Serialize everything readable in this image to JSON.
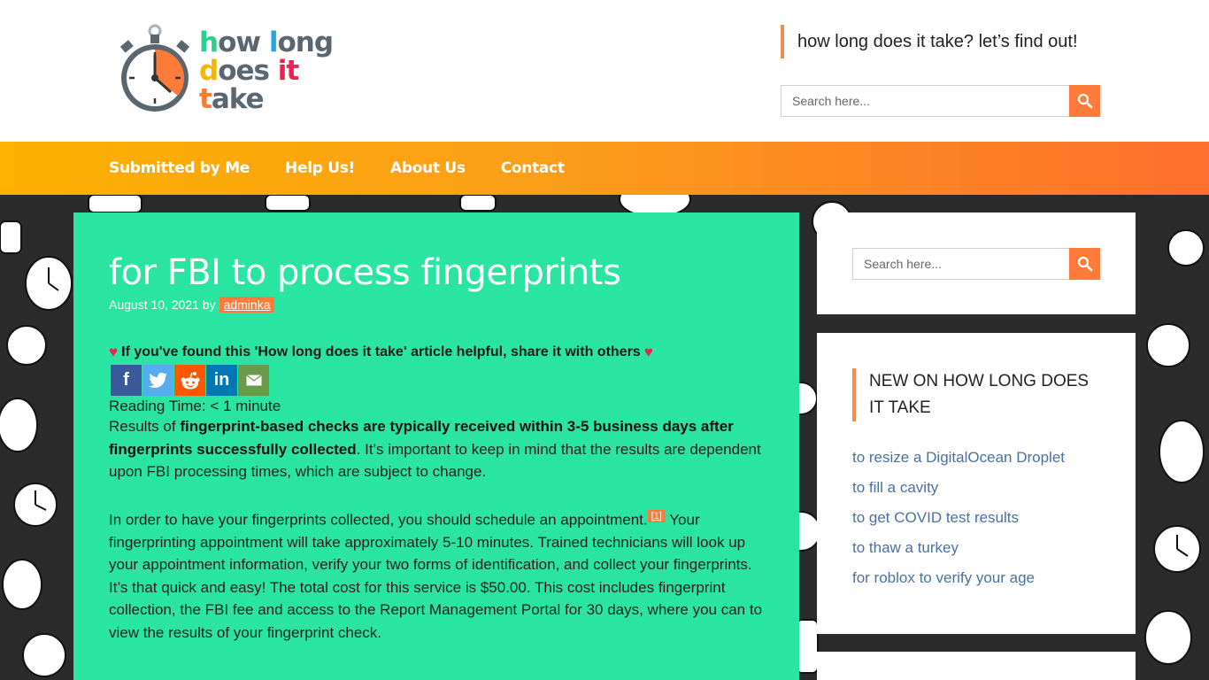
{
  "site": {
    "logo_lines": [
      [
        "how",
        " ",
        "l",
        "ong"
      ],
      [
        "d",
        "oes ",
        "it"
      ],
      [
        "t",
        "ake"
      ]
    ],
    "logo_alt": "how long does it take",
    "tagline": "how long does it take? let’s find out!"
  },
  "header_search": {
    "placeholder": "Search here...",
    "button_icon": "search-icon"
  },
  "nav": {
    "items": [
      {
        "label": "Submitted by Me"
      },
      {
        "label": "Help Us!"
      },
      {
        "label": "About Us"
      },
      {
        "label": "Contact"
      }
    ]
  },
  "post": {
    "title": "for FBI to process fingerprints",
    "date": "August 10, 2021",
    "by": "by",
    "author": "adminka",
    "share_text": "If you've found this 'How long does it take' article helpful, share it with others",
    "social": [
      {
        "name": "facebook",
        "glyph": "f",
        "color": "#3b5998"
      },
      {
        "name": "twitter",
        "glyph": "t",
        "color": "#55acee"
      },
      {
        "name": "reddit",
        "glyph": "r",
        "color": "#ff5700"
      },
      {
        "name": "linkedin",
        "glyph": "in",
        "color": "#0077b5"
      },
      {
        "name": "email",
        "glyph": "✉",
        "color": "#6a9a4a"
      }
    ],
    "reading_time": "Reading Time: < 1 minute",
    "p1_pre": "Results of ",
    "p1_bold": "fingerprint-based checks are typically received within 3-5 business days after fingerprints successfully collected",
    "p1_post": ". It’s important to keep in mind that the results are dependent upon FBI processing times, which are subject to change.",
    "p2_pre": "In order to have your fingerprints collected, you should schedule an appointment.",
    "p2_cite": "[1]",
    "p2_post": " Your fingerprinting appointment will take approximately 5-10 minutes. Trained technicians will look up your appointment information, verify your two forms of identification, and collect your fingerprints. It’s that quick and easy! The total cost for this service is $50.00. This cost includes fingerprint collection, the FBI fee and access to the Report Management Portal for 30 days, where you can to view the results of your fingerprint check."
  },
  "sidebar": {
    "search_placeholder": "Search here...",
    "new_title": "NEW ON HOW LONG DOES IT TAKE",
    "new_items": [
      {
        "label": "to resize a DigitalOcean Droplet"
      },
      {
        "label": "to fill a cavity"
      },
      {
        "label": "to get COVID test results"
      },
      {
        "label": "to thaw a turkey"
      },
      {
        "label": "for roblox to verify your age"
      }
    ]
  },
  "colors": {
    "accent": "#ff7b39",
    "content_bg": "#2ae4a1",
    "link": "#4a6fa5",
    "nav_start": "#fdb100",
    "nav_end": "#ff6f2d"
  }
}
